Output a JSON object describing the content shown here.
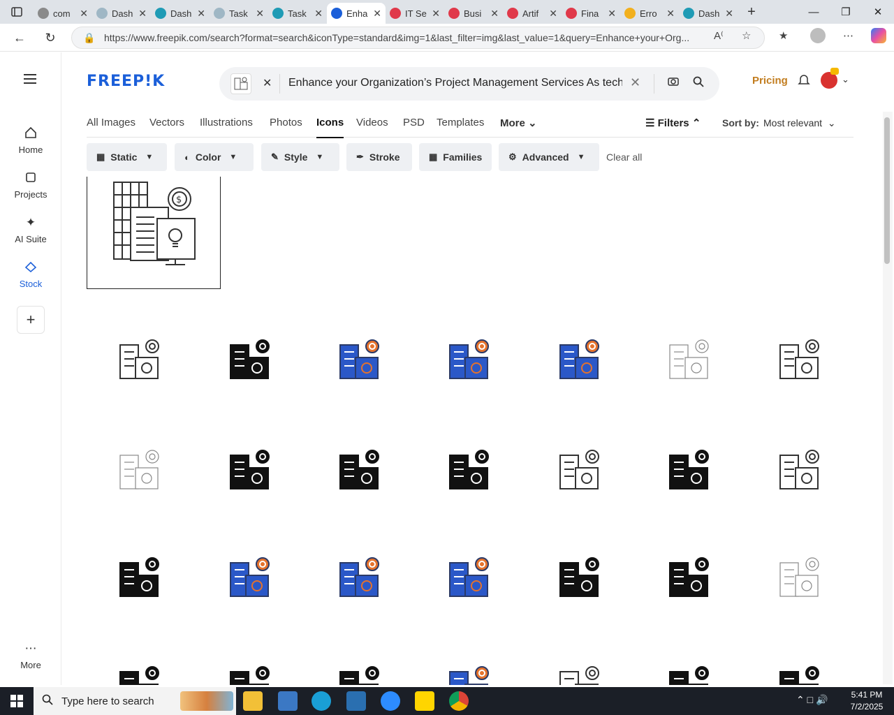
{
  "browser": {
    "tabs": [
      {
        "label": "com",
        "favicon": "#8a8a8a",
        "active": false
      },
      {
        "label": "Dash",
        "favicon": "#9fb7c5",
        "active": false
      },
      {
        "label": "Dash",
        "favicon": "#1f9bb5",
        "active": false
      },
      {
        "label": "Task",
        "favicon": "#9fb7c5",
        "active": false
      },
      {
        "label": "Task",
        "favicon": "#1f9bb5",
        "active": false
      },
      {
        "label": "Enha",
        "favicon": "#1b5fd9",
        "active": true
      },
      {
        "label": "IT Se",
        "favicon": "#e0394a",
        "active": false
      },
      {
        "label": "Busi",
        "favicon": "#e0394a",
        "active": false
      },
      {
        "label": "Artif",
        "favicon": "#e0394a",
        "active": false
      },
      {
        "label": "Fina",
        "favicon": "#e0394a",
        "active": false
      },
      {
        "label": "Erro",
        "favicon": "#f2b01e",
        "active": false
      },
      {
        "label": "Dash",
        "favicon": "#1f9bb5",
        "active": false
      }
    ],
    "url": "https://www.freepik.com/search?format=search&iconType=standard&img=1&last_filter=img&last_value=1&query=Enhance+your+Org..."
  },
  "sidebar": {
    "items": [
      {
        "label": "Home",
        "icon": "home-icon"
      },
      {
        "label": "Projects",
        "icon": "folder-icon"
      },
      {
        "label": "AI Suite",
        "icon": "sparkle-icon"
      },
      {
        "label": "Stock",
        "icon": "stock-icon"
      }
    ],
    "more_label": "More"
  },
  "header": {
    "logo": "FREEP!K",
    "search_query": "Enhance your Organization’s Project Management Services As tech",
    "pricing_label": "Pricing"
  },
  "category_tabs": [
    "All Images",
    "Vectors",
    "Illustrations",
    "Photos",
    "Icons",
    "Videos",
    "PSD",
    "Templates",
    "More"
  ],
  "active_tab": "Icons",
  "filters_label": "Filters",
  "sort": {
    "label": "Sort by:",
    "value": "Most relevant"
  },
  "chips": [
    {
      "label": "Static",
      "icon": "static-icon",
      "dropdown": true
    },
    {
      "label": "Color",
      "icon": "palette-icon",
      "dropdown": true
    },
    {
      "label": "Style",
      "icon": "brush-icon",
      "dropdown": true
    },
    {
      "label": "Stroke",
      "icon": "pen-icon",
      "dropdown": false
    },
    {
      "label": "Families",
      "icon": "grid-icon",
      "dropdown": false
    },
    {
      "label": "Advanced",
      "icon": "gear-icon",
      "dropdown": true
    }
  ],
  "clear_all_label": "Clear all",
  "results": {
    "rows": [
      [
        "outline",
        "solid",
        "color",
        "color",
        "color",
        "outline-light",
        "outline"
      ],
      [
        "outline-light",
        "solid",
        "solid",
        "solid",
        "outline",
        "solid",
        "outline"
      ],
      [
        "solid",
        "color",
        "color",
        "color",
        "solid",
        "solid",
        "outline-light"
      ],
      [
        "solid",
        "solid",
        "solid",
        "color",
        "outline",
        "solid",
        "solid"
      ]
    ]
  },
  "taskbar": {
    "search_placeholder": "Type here to search",
    "time": "5:41 PM",
    "date": "7/2/2025"
  },
  "colors": {
    "brand": "#1b5fd9",
    "pricing": "#c27d1f",
    "icon_blue": "#2b58c8",
    "icon_orange": "#e5722c",
    "icon_pink": "#d23a85"
  }
}
